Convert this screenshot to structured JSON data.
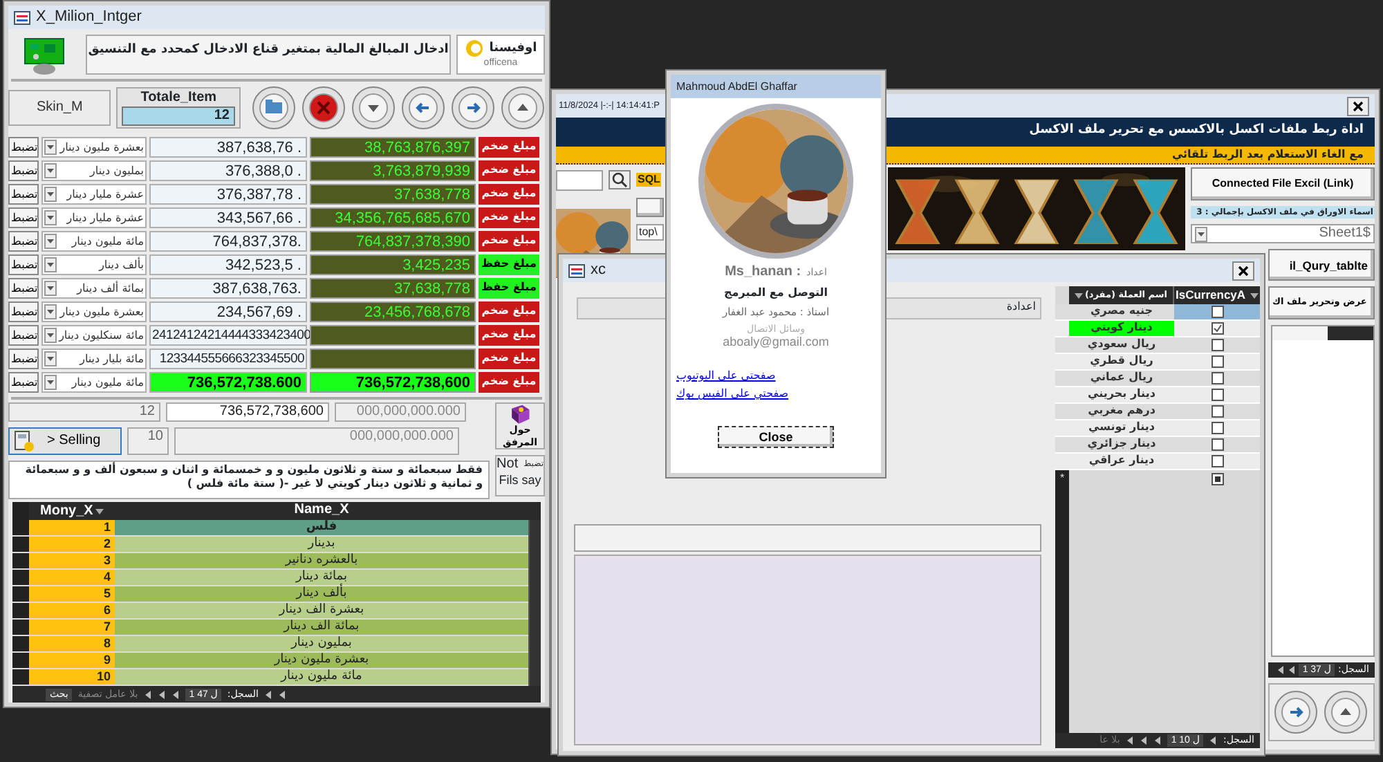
{
  "left_window": {
    "title": "X_Milion_Intger",
    "header": "ادخال المبالغ المالية  بمتغير قناع الادخال كمحدد مع التنسيق",
    "logo": {
      "name": "اوفيسنا",
      "tagline": "officena"
    },
    "skin": "Skin_M",
    "total": {
      "label": "Totale_Item",
      "value": "12"
    },
    "rows": [
      {
        "button": "تضبط",
        "unit": "بعشرة مليون دينار",
        "amount": "387,638,76 .",
        "result": "38,763,876,397",
        "highlight": false,
        "status": "مبلغ ضخم",
        "kind": "large"
      },
      {
        "button": "تضبط",
        "unit": "بمليون دينار",
        "amount": "376,388,0 .",
        "result": "3,763,879,939",
        "highlight": false,
        "status": "مبلغ ضخم",
        "kind": "large"
      },
      {
        "button": "تضبط",
        "unit": "عشرة مليار دينار",
        "amount": "376,387,78 .",
        "result": "37,638,778",
        "highlight": false,
        "status": "مبلغ ضخم",
        "kind": "large"
      },
      {
        "button": "تضبط",
        "unit": "عشرة مليار دينار",
        "amount": "343,567,66 .",
        "result": "34,356,765,685,670",
        "highlight": false,
        "status": "مبلغ ضخم",
        "kind": "large"
      },
      {
        "button": "تضبط",
        "unit": "مائة مليون دينار",
        "amount": "764,837,378.",
        "result": "764,837,378,390",
        "highlight": false,
        "status": "مبلغ ضخم",
        "kind": "large"
      },
      {
        "button": "تضبط",
        "unit": "بألف دينار",
        "amount": "342,523,5 .",
        "result": "3,425,235",
        "highlight": false,
        "status": "مبلغ حفظ",
        "kind": "saved"
      },
      {
        "button": "تضبط",
        "unit": "بمائة ألف دينار",
        "amount": "387,638,763.",
        "result": "37,638,778",
        "highlight": false,
        "status": "مبلغ حفظ",
        "kind": "saved"
      },
      {
        "button": "تضبط",
        "unit": "بعشرة مليون دينار",
        "amount": "234,567,69 .",
        "result": "23,456,768,678",
        "highlight": false,
        "status": "مبلغ ضخم",
        "kind": "large"
      },
      {
        "button": "تضبط",
        "unit": "مائة سنكليون دينار",
        "amount": "24124124214444333423400",
        "highlight": false,
        "status": "مبلغ ضخم",
        "kind": "large"
      },
      {
        "button": "تضبط",
        "unit": "مائة بليار دينار",
        "amount": "123344555666323345500",
        "highlight": false,
        "status": "مبلغ ضخم",
        "kind": "large"
      },
      {
        "button": "تضبط",
        "unit": "مائة مليون دينار",
        "amount": "736,572,738.600",
        "result": "736,572,738,600",
        "highlight": true,
        "status": "مبلغ ضخم",
        "kind": "large"
      }
    ],
    "summary": {
      "count": "12",
      "total": "736,572,738,600",
      "zero_1": "000,000,000.000",
      "selling": "> Selling",
      "count_2": "10",
      "zero_2": "000,000,000.000",
      "about": "حول المرفق",
      "words": "فقط سبعمائة و ستة و ثلاثون مليون و و خمسمائة و اثنان و سبعون ألف و و سبعمائة و ثمانية و ثلاثون دينار كويتي لا غير -(   ستة مائة فلس )",
      "fils": {
        "top": "Not",
        "tag": "تضبط",
        "bottom": "Fils say"
      }
    },
    "grid": {
      "columns": [
        "Name_X",
        "Mony_X"
      ],
      "rows": [
        {
          "mony": "1",
          "name": "فلس",
          "selected": true
        },
        {
          "mony": "2",
          "name": "بدينار",
          "selected": false
        },
        {
          "mony": "3",
          "name": "بالعشره دنانير",
          "selected": false
        },
        {
          "mony": "4",
          "name": "بمائة دينار",
          "selected": false
        },
        {
          "mony": "5",
          "name": "بألف دينار",
          "selected": false
        },
        {
          "mony": "6",
          "name": "بعشرة الف دينار",
          "selected": false
        },
        {
          "mony": "7",
          "name": "بمائة الف دينار",
          "selected": false
        },
        {
          "mony": "8",
          "name": "بمليون دينار",
          "selected": false
        },
        {
          "mony": "9",
          "name": "بعشرة مليون دينار",
          "selected": false
        },
        {
          "mony": "10",
          "name": "مائة مليون دينار",
          "selected": false
        }
      ],
      "nav": {
        "search": "بحث",
        "filter": "بلا عامل تصفية",
        "record_label": "السجل:",
        "record": "1 ل 47"
      }
    }
  },
  "right_window": {
    "title": "11/8/2024 |-:-| 14:14:41:P",
    "header": "اداة ربط ملفات اكسل بالاكسس مع تحرير ملف الاكسل",
    "subheader": "مع الغاء الاستعلام بعد الربط تلقائي",
    "sql_label": "SQL",
    "query_field": "top\\",
    "connect_button": "Connected File Excil (Link)",
    "sheets_label": "اسماء الاوراق في ملف الاكسل بإجمالي : 3",
    "sheet": "Sheet1$",
    "query_button": "il_Qury_tablte",
    "view_button": "عرض وتحرير ملف اك",
    "nav": {
      "record_label": "السجل:",
      "record": "1 ل 37"
    }
  },
  "xc_window": {
    "title": "xc",
    "label": "اعدادة",
    "columns": [
      "IsCurrencyA",
      "اسم العملة (مفرد)"
    ],
    "rows": [
      {
        "name": "جنيه مصري",
        "checked": false,
        "selected": true,
        "highlight": false
      },
      {
        "name": "دينار كويتي",
        "checked": true,
        "selected": false,
        "highlight": true
      },
      {
        "name": "ريال سعودي",
        "checked": false,
        "selected": false,
        "highlight": false
      },
      {
        "name": "ريال قطري",
        "checked": false,
        "selected": false,
        "highlight": false
      },
      {
        "name": "ريال عماني",
        "checked": false,
        "selected": false,
        "highlight": false
      },
      {
        "name": "دينار بحريني",
        "checked": false,
        "selected": false,
        "highlight": false
      },
      {
        "name": "درهم مغربي",
        "checked": false,
        "selected": false,
        "highlight": false
      },
      {
        "name": "دينار تونسي",
        "checked": false,
        "selected": false,
        "highlight": false
      },
      {
        "name": "دينار جزائري",
        "checked": false,
        "selected": false,
        "highlight": false
      },
      {
        "name": "دينار عراقي",
        "checked": false,
        "selected": false,
        "highlight": false
      }
    ],
    "new_row": {
      "marker": "*",
      "indeterminate": true
    },
    "nav": {
      "filter": "بلا عا",
      "record_label": "السجل:",
      "record": "1 ل 10"
    }
  },
  "popup": {
    "title": "Mahmoud AbdEl Ghaffar",
    "prepared_name": "Ms_hanan :",
    "prepared_label": "اعداد",
    "contact_title": "التوصل مع المبرمج",
    "teacher": "استاذ : محمود عبد الغفار",
    "means": "وسائل الاتصال",
    "email": "aboaly@gmail.com",
    "links": [
      "صفحتي على اليوتيوب",
      "صفحتي على الفيس بوك"
    ],
    "close": "Close"
  }
}
